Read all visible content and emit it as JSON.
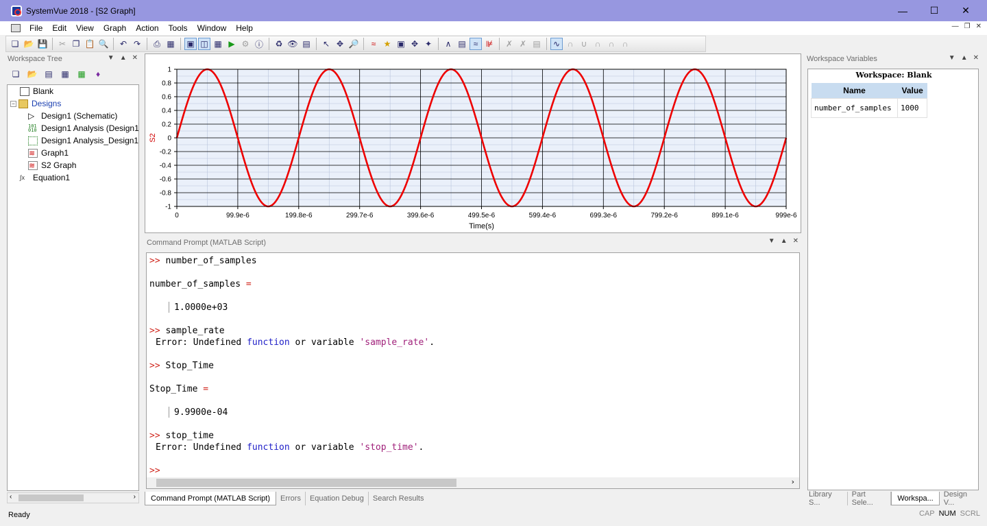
{
  "window": {
    "title": "SystemVue 2018 - [S2 Graph]",
    "min_icon": "minimize-icon",
    "max_icon": "maximize-icon",
    "close_icon": "close-icon"
  },
  "menu": [
    "File",
    "Edit",
    "View",
    "Graph",
    "Action",
    "Tools",
    "Window",
    "Help"
  ],
  "workspace_tree": {
    "header": "Workspace Tree",
    "items": [
      {
        "label": "Blank",
        "icon": "workspace-icon",
        "level": 0
      },
      {
        "label": "Designs",
        "icon": "folder-icon",
        "level": 0,
        "color": "#1a3fb0"
      },
      {
        "label": "Design1 (Schematic)",
        "icon": "schematic-icon",
        "level": 1
      },
      {
        "label": "Design1 Analysis (Design1)",
        "icon": "analysis-icon",
        "level": 1
      },
      {
        "label": "Design1 Analysis_Design1_",
        "icon": "analysis-table-icon",
        "level": 1
      },
      {
        "label": "Graph1",
        "icon": "graph-icon",
        "level": 1
      },
      {
        "label": "S2 Graph",
        "icon": "graph-icon",
        "level": 1
      },
      {
        "label": "Equation1",
        "icon": "equation-icon",
        "level": 0
      }
    ]
  },
  "chart_data": {
    "type": "line",
    "title": "",
    "xlabel": "Time(s)",
    "ylabel": "S2",
    "xlim": [
      0,
      0.000999
    ],
    "ylim": [
      -1,
      1
    ],
    "x_ticks": [
      "0",
      "99.9e-6",
      "199.8e-6",
      "299.7e-6",
      "399.6e-6",
      "499.5e-6",
      "599.4e-6",
      "699.3e-6",
      "799.2e-6",
      "899.1e-6",
      "999e-6"
    ],
    "y_ticks": [
      "1",
      "0.8",
      "0.6",
      "0.4",
      "0.2",
      "0",
      "-0.2",
      "-0.4",
      "-0.6",
      "-0.8",
      "-1"
    ],
    "grid": true,
    "series": [
      {
        "color": "#ee0000",
        "function": "sin",
        "amplitude": 1,
        "cycles_in_window": 5,
        "frequency_hz": 5005
      }
    ]
  },
  "command_prompt": {
    "header": "Command Prompt (MATLAB Script)",
    "prompt_symbol": ">>",
    "lines": {
      "cmd1": "number_of_samples",
      "var1": "number_of_samples",
      "eq": "=",
      "val1": "1.0000e+03",
      "cmd2": "sample_rate",
      "err_prefix": "Error: Undefined ",
      "err_kw": "function",
      "err_mid": " or variable ",
      "err2_name": "'sample_rate'",
      "err_end": ".",
      "cmd3": "Stop_Time",
      "var3": "Stop_Time",
      "val3": "9.9900e-04",
      "cmd4": "stop_time",
      "err4_name": "'stop_time'"
    }
  },
  "bottom_tabs": [
    "Command Prompt (MATLAB Script)",
    "Errors",
    "Equation Debug",
    "Search Results"
  ],
  "workspace_variables": {
    "header": "Workspace Variables",
    "title": "Workspace: Blank",
    "columns": [
      "Name",
      "Value"
    ],
    "rows": [
      {
        "name": "number_of_samples",
        "value": "1000"
      }
    ]
  },
  "right_tabs": [
    "Library S...",
    "Part Sele...",
    "Workspa...",
    "Design V..."
  ],
  "status": {
    "text": "Ready",
    "cap": "CAP",
    "num": "NUM",
    "scrl": "SCRL"
  }
}
